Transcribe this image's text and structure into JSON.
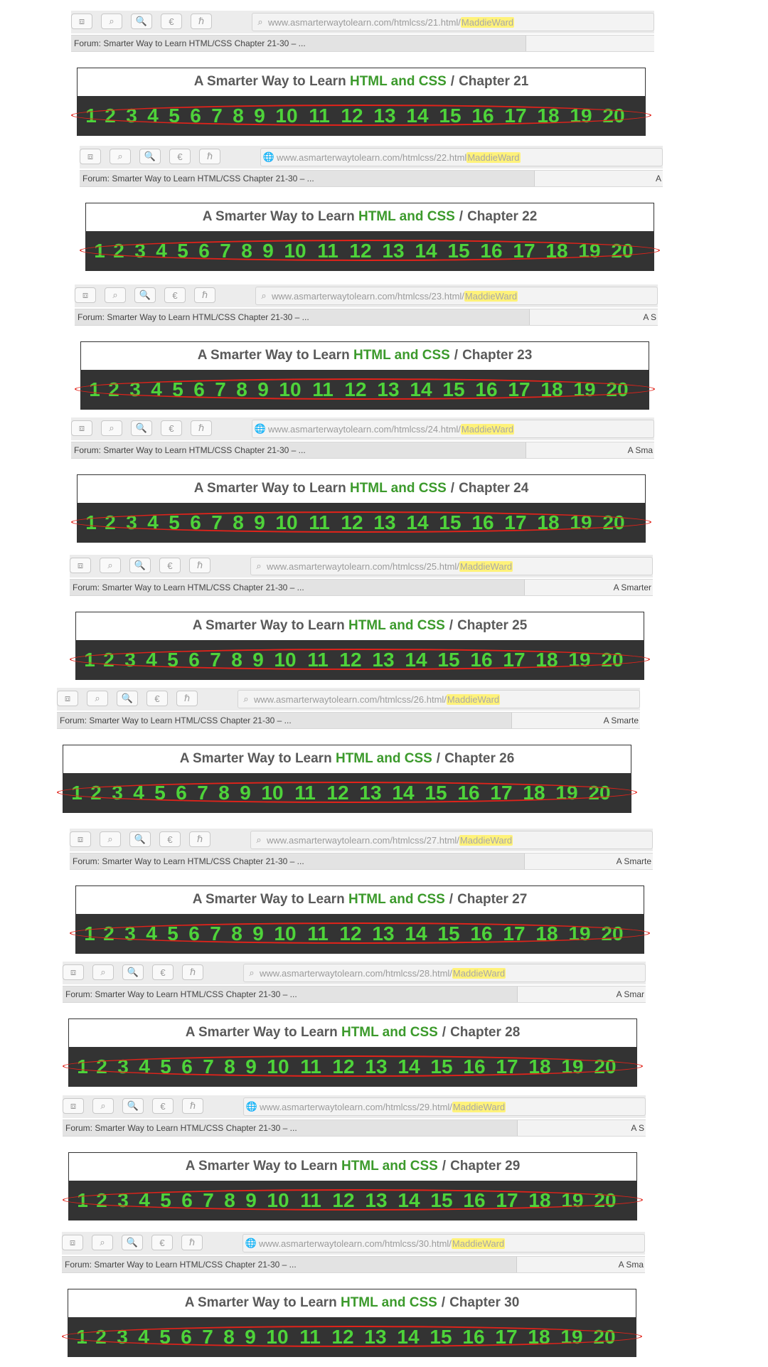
{
  "toolbar": {
    "icons": [
      "disk-icon",
      "search-icon",
      "magnifier-icon",
      "evernote-icon",
      "helper-icon"
    ],
    "icon_glyphs": [
      "⧈",
      "⌕",
      "🔍",
      "€",
      "ℏ"
    ]
  },
  "tab_active_label": "Forum: Smarter Way to Learn HTML/CSS Chapter 21-30 – ...",
  "header": {
    "prefix": "A Smarter Way to Learn ",
    "topic": "HTML and CSS",
    "separator": "/"
  },
  "chapter_links": [
    "1",
    "2",
    "3",
    "4",
    "5",
    "6",
    "7",
    "8",
    "9",
    "10",
    "11",
    "12",
    "13",
    "14",
    "15",
    "16",
    "17",
    "18",
    "19",
    "20"
  ],
  "accent_colors": {
    "title_green": "#3c9a2c",
    "link_green": "#4ed33a",
    "annotation_red": "#e2231a",
    "bar_dark": "#333333"
  },
  "screenshots": [
    {
      "url_base": "www.asmarterwaytolearn.com/htmlcss/21.html/",
      "url_user": "MaddieWard",
      "url_icon": "search",
      "tab_other": "",
      "chapter": "Chapter 21"
    },
    {
      "url_base": "www.asmarterwaytolearn.com/htmlcss/22.html",
      "url_user": "MaddieWard",
      "url_icon": "globe",
      "tab_other": "A",
      "chapter": "Chapter 22"
    },
    {
      "url_base": "www.asmarterwaytolearn.com/htmlcss/23.html/",
      "url_user": "MaddieWard",
      "url_icon": "search",
      "tab_other": "A S",
      "chapter": "Chapter 23"
    },
    {
      "url_base": "www.asmarterwaytolearn.com/htmlcss/24.html/",
      "url_user": "MaddieWard",
      "url_icon": "globe",
      "tab_other": "A Sma",
      "chapter": "Chapter 24"
    },
    {
      "url_base": "www.asmarterwaytolearn.com/htmlcss/25.html/",
      "url_user": "MaddieWard",
      "url_icon": "search",
      "tab_other": "A Smarter",
      "chapter": "Chapter 25"
    },
    {
      "url_base": "www.asmarterwaytolearn.com/htmlcss/26.html/",
      "url_user": "MaddieWard",
      "url_icon": "search",
      "tab_other": "A Smarte",
      "chapter": "Chapter 26"
    },
    {
      "url_base": "www.asmarterwaytolearn.com/htmlcss/27.html/",
      "url_user": "MaddieWard",
      "url_icon": "search",
      "tab_other": "A Smarte",
      "chapter": "Chapter 27"
    },
    {
      "url_base": "www.asmarterwaytolearn.com/htmlcss/28.html/",
      "url_user": "MaddieWard",
      "url_icon": "search",
      "tab_other": "A Smar",
      "chapter": "Chapter 28"
    },
    {
      "url_base": "www.asmarterwaytolearn.com/htmlcss/29.html/",
      "url_user": "MaddieWard",
      "url_icon": "globe",
      "tab_other": "A S",
      "chapter": "Chapter 29"
    },
    {
      "url_base": "www.asmarterwaytolearn.com/htmlcss/30.html/",
      "url_user": "MaddieWard",
      "url_icon": "globe",
      "tab_other": "A Sma",
      "chapter": "Chapter 30"
    }
  ]
}
